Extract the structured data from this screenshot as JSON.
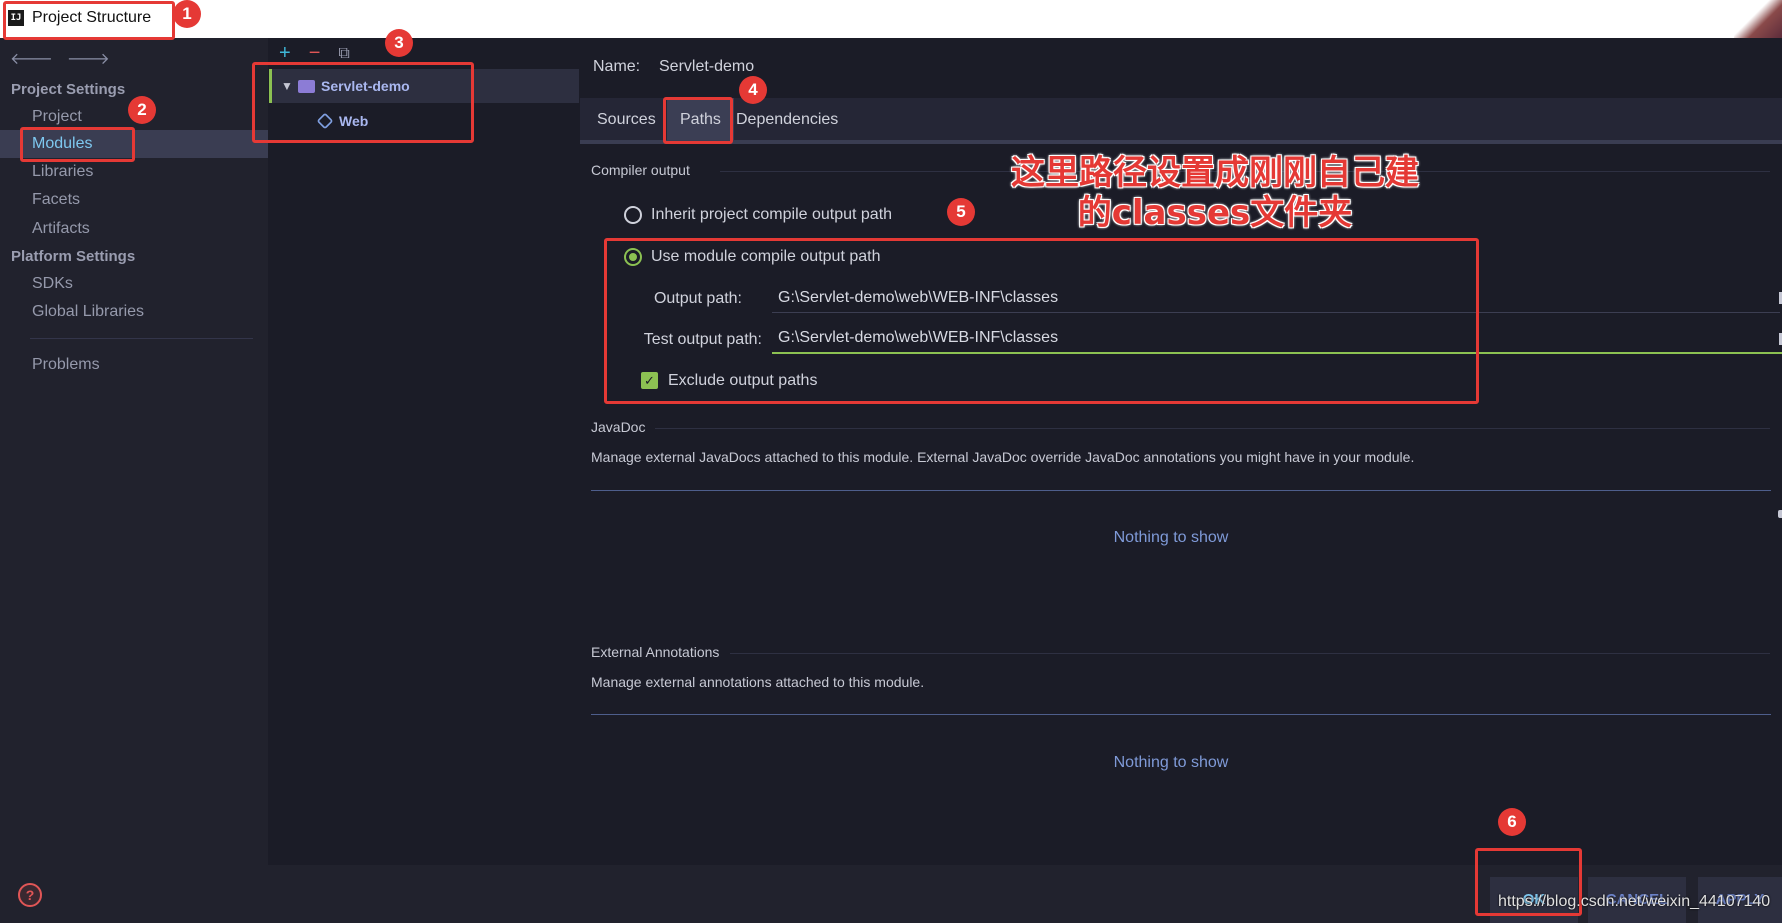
{
  "window": {
    "title": "Project Structure",
    "app_icon": "intellij-idea-icon"
  },
  "nav": {
    "back_icon": "arrow-left-icon",
    "forward_icon": "arrow-right-icon",
    "project_settings_title": "Project Settings",
    "platform_settings_title": "Platform Settings",
    "items": {
      "project": "Project",
      "modules": "Modules",
      "libraries": "Libraries",
      "facets": "Facets",
      "artifacts": "Artifacts",
      "sdks": "SDKs",
      "global_libraries": "Global Libraries",
      "problems": "Problems"
    },
    "selected": "Modules"
  },
  "tree": {
    "toolbar": {
      "add": "+",
      "remove": "−",
      "copy": "⧉"
    },
    "module_name": "Servlet-demo",
    "facet_name": "Web"
  },
  "main": {
    "name_label": "Name:",
    "name_value": "Servlet-demo",
    "tabs": {
      "sources": "Sources",
      "paths": "Paths",
      "dependencies": "Dependencies"
    },
    "active_tab": "Paths",
    "compiler": {
      "title": "Compiler output",
      "inherit_label": "Inherit project compile output path",
      "use_module_label": "Use module compile output path",
      "selected": "use_module",
      "output_label": "Output path:",
      "output_value": "G:\\Servlet-demo\\web\\WEB-INF\\classes",
      "test_label": "Test output path:",
      "test_value": "G:\\Servlet-demo\\web\\WEB-INF\\classes",
      "exclude_label": "Exclude output paths",
      "exclude_checked": true
    },
    "javadoc": {
      "title": "JavaDoc",
      "desc": "Manage external JavaDocs attached to this module. External JavaDoc override JavaDoc annotations you might have in your module.",
      "empty": "Nothing to show"
    },
    "annotations": {
      "title": "External Annotations",
      "desc": "Manage external annotations attached to this module.",
      "empty": "Nothing to show"
    }
  },
  "buttons": {
    "ok": "OK",
    "cancel": "CANCEL",
    "apply": "APPLY",
    "help": "?"
  },
  "annotations": {
    "n1": "1",
    "n2": "2",
    "n3": "3",
    "n4": "4",
    "n5": "5",
    "n6": "6",
    "note_line1": "这里路径设置成刚刚自己建",
    "note_line2": "的classes文件夹",
    "color": "#e53935"
  },
  "watermark": "https://blog.csdn.net/weixin_44107140",
  "colors": {
    "accent": "#8cc152",
    "selected_text": "#7ec8f0",
    "link": "#7f9ad8"
  }
}
